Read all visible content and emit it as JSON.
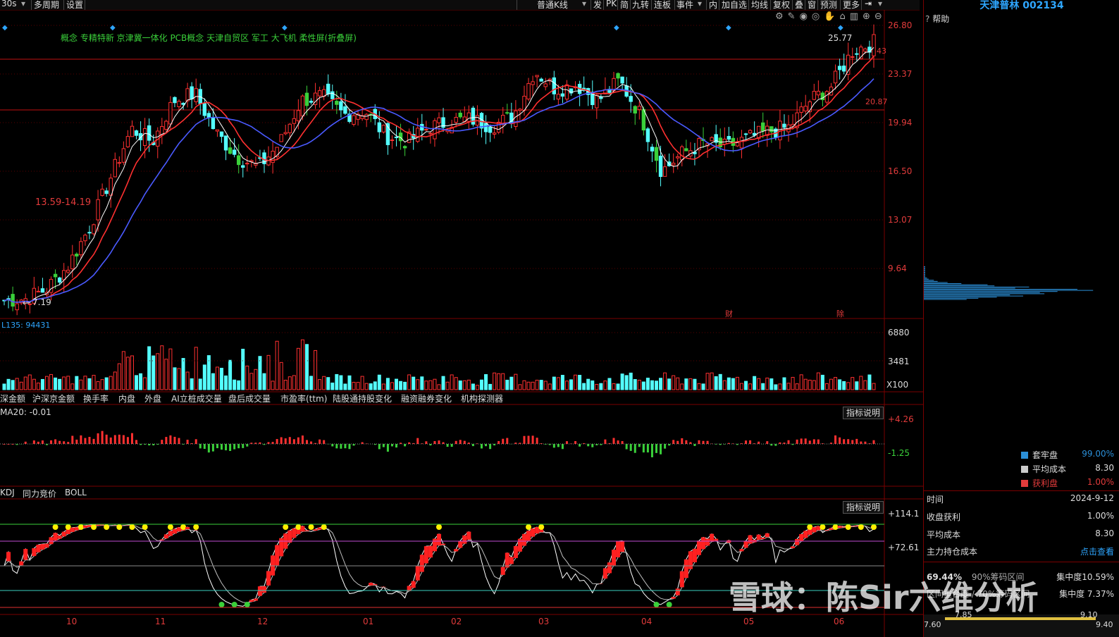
{
  "toolbar": {
    "left_items": [
      "30s",
      "多周期",
      "设置"
    ],
    "kline_type": "普通K线",
    "right_items": [
      "发",
      "PK",
      "简",
      "九转",
      "连板",
      "事件",
      "内",
      "加自选",
      "均线",
      "复权",
      "叠",
      "窗",
      "预测",
      "更多"
    ]
  },
  "right_panel": {
    "title": "天津普林 002134",
    "help_label": "帮助",
    "legend": [
      {
        "label": "套牢盘",
        "value": "99.00%",
        "color": "#2b8fd8"
      },
      {
        "label": "平均成本",
        "value": "8.30",
        "color": "#cccccc"
      },
      {
        "label": "获利盘",
        "value": "1.00%",
        "color": "#e23b3b"
      }
    ],
    "info": [
      {
        "label": "时间",
        "value": "2024-9-12"
      },
      {
        "label": "收盘获利",
        "value": "1.00%"
      },
      {
        "label": "平均成本",
        "value": "8.30"
      },
      {
        "label": "主力持仓成本",
        "value": "点击查看"
      }
    ],
    "concentration": [
      {
        "pct": "69.44%",
        "text": "90%筹码区间",
        "tail": "集中度10.59%"
      },
      {
        "pct": "",
        "text": "区间重合度 / 70%筹码区间",
        "tail": "集中度 7.37%"
      }
    ],
    "range_bottom": [
      "7.60",
      "7.85",
      "9.10",
      "9.40"
    ]
  },
  "main_chart": {
    "concept_line": "概念  专精特新  京津冀一体化  PCB概念  天津自贸区  军工  大飞机  柔性屏(折叠屏)",
    "price_ticks": [
      "26.80",
      "23.37",
      "19.94",
      "16.50",
      "13.07",
      "9.64"
    ],
    "high_label": "25.77",
    "low_label": "7.19",
    "right_price_tag": "20.87",
    "right_price_tag2": "43",
    "range_label": "13.59-14.19",
    "event_labels": [
      "财",
      "除"
    ],
    "month_labels": [
      "10",
      "11",
      "12",
      "01",
      "02",
      "03",
      "04",
      "05",
      "06"
    ]
  },
  "volume_panel": {
    "header": "L135: 94431",
    "ticks": [
      "6880",
      "3481",
      "X100"
    ]
  },
  "indicator_tabs": [
    "深金额",
    "沪深京金额",
    "换手率",
    "内盘",
    "外盘",
    "AI立桩成交量",
    "盘后成交量",
    "市盈率(ttm)",
    "陆股通持股变化",
    "融资融券变化",
    "机构探测器"
  ],
  "macd_panel": {
    "header": "MA20: -0.01",
    "explain_button": "指标说明",
    "ticks": [
      "+4.26",
      "-1.25"
    ]
  },
  "kdj_panel": {
    "tabs": [
      "KDJ",
      "同力竞价",
      "BOLL"
    ],
    "explain_button": "指标说明",
    "ticks": [
      "+114.1",
      "+72.61"
    ]
  },
  "watermark": "雪球：陈Sir六维分析",
  "chart_data": {
    "type": "candlestick",
    "title": "",
    "x_labels": [
      "10",
      "11",
      "12",
      "01",
      "02",
      "03",
      "04",
      "05",
      "06"
    ],
    "y_ticks": [
      9.64,
      13.07,
      16.5,
      19.94,
      23.37,
      26.8
    ],
    "annotations": [
      "25.77",
      "7.19",
      "13.59-14.19",
      "20.87"
    ],
    "close_path": [
      7.4,
      7.5,
      8.2,
      9.8,
      12.5,
      16,
      19.5,
      18.6,
      21.5,
      22.0,
      19.2,
      17.5,
      16.8,
      18.5,
      21.5,
      21.8,
      20.5,
      20.8,
      19.0,
      18.6,
      19.6,
      20.0,
      20.2,
      19.7,
      20.4,
      23.6,
      22.3,
      22.6,
      21.5,
      22.9,
      20.5,
      16.5,
      17.8,
      18.5,
      18.2,
      18.8,
      19.3,
      19.6,
      21.5,
      22.5,
      25.0,
      25.6
    ]
  }
}
